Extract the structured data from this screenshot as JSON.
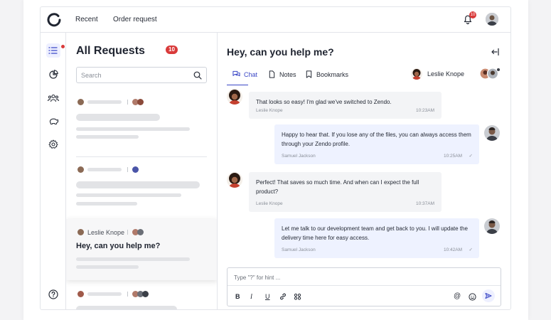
{
  "topbar": {
    "nav": [
      "Recent",
      "Order request"
    ],
    "notifications_count": "10"
  },
  "list": {
    "title": "All Requests",
    "count": "10",
    "search_placeholder": "Search",
    "active_request": {
      "name": "Leslie Knope",
      "subject": "Hey, can you help me?"
    }
  },
  "chat": {
    "title": "Hey, can you help me?",
    "tabs": [
      "Chat",
      "Notes",
      "Bookmarks"
    ],
    "assignee": "Leslie Knope",
    "messages": [
      {
        "direction": "in",
        "text": "That looks so easy! I'm glad we've switched to Zendo.",
        "author": "Leslie Knope",
        "time": "10:23AM"
      },
      {
        "direction": "out",
        "text": "Happy to hear that. If you lose any of the files, you can always access them through your Zendo profile.",
        "author": "Samuel Jackson",
        "time": "10:25AM"
      },
      {
        "direction": "in",
        "text": "Perfect! That saves so much time. And when can I expect the full product?",
        "author": "Leslie Knope",
        "time": "10:37AM"
      },
      {
        "direction": "out",
        "text": "Let me talk to our development team and get back to you. I will update the delivery time here for easy access.",
        "author": "Samuel Jackson",
        "time": "10:42AM"
      }
    ],
    "composer_placeholder": "Type \"?\" for hint ...",
    "format_buttons": [
      "B",
      "I",
      "U"
    ]
  },
  "colors": {
    "accent": "#3a47c6",
    "badge": "#d93a3a",
    "incoming_bubble": "#f3f4f6",
    "outgoing_bubble": "#eef2ff"
  }
}
